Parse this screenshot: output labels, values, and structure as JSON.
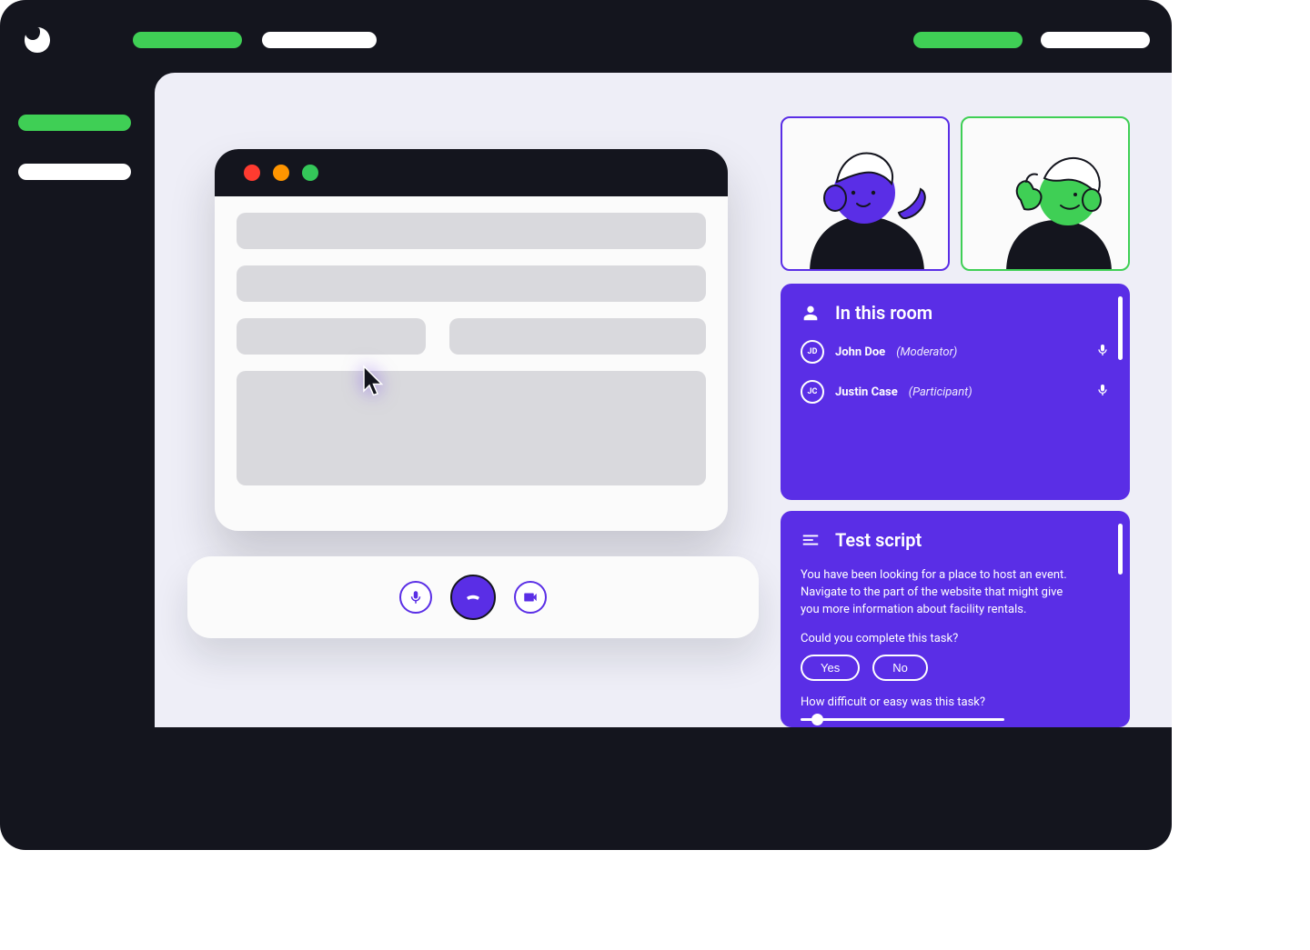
{
  "colors": {
    "accent_purple": "#5a2ee6",
    "accent_green": "#3fcf55",
    "dark": "#14151e"
  },
  "room_panel": {
    "title": "In this room",
    "members": [
      {
        "initials": "JD",
        "name": "John Doe",
        "role": "(Moderator)"
      },
      {
        "initials": "JC",
        "name": "Justin Case",
        "role": "(Participant)"
      }
    ]
  },
  "script_panel": {
    "title": "Test script",
    "body": "You have been looking for a place to host an event. Navigate to the part of the website that might give you more information about facility rentals.",
    "q1": "Could you complete this task?",
    "yes_label": "Yes",
    "no_label": "No",
    "q2": "How difficult or easy was this task?"
  }
}
